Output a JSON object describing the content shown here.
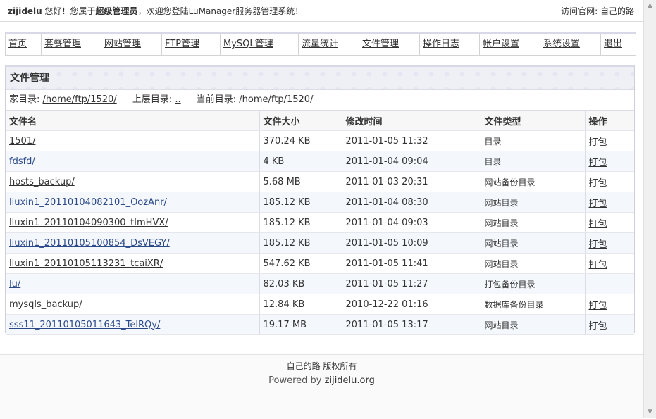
{
  "topbar": {
    "username": "zijidelu",
    "greeting": " 您好！您属于",
    "role": "超级管理员",
    "welcome": "，欢迎您登陆LuManager服务器管理系统！",
    "visit_label": "访问官网:",
    "visit_link": "自己的路"
  },
  "nav": {
    "items": [
      {
        "label": "首页"
      },
      {
        "label": "套餐管理"
      },
      {
        "label": "网站管理"
      },
      {
        "label": "FTP管理"
      },
      {
        "label": "MySQL管理"
      },
      {
        "label": "流量统计"
      },
      {
        "label": "文件管理"
      },
      {
        "label": "操作日志"
      },
      {
        "label": "帐户设置"
      },
      {
        "label": "系统设置"
      },
      {
        "label": "退出"
      }
    ]
  },
  "panel": {
    "title": "文件管理",
    "home_label": "家目录:",
    "home_path": "/home/ftp/1520/",
    "parent_label": "上层目录:",
    "parent_path": "..",
    "current_label": "当前目录:",
    "current_path": "/home/ftp/1520/"
  },
  "table": {
    "headers": [
      "文件名",
      "文件大小",
      "修改时间",
      "文件类型",
      "操作"
    ],
    "rows": [
      {
        "name": "1501/",
        "size": "370.24 KB",
        "mtime": "2011-01-05 11:32",
        "type": "目录",
        "action": "打包"
      },
      {
        "name": "fdsfd/",
        "size": "4 KB",
        "mtime": "2011-01-04 09:04",
        "type": "目录",
        "action": "打包"
      },
      {
        "name": "hosts_backup/",
        "size": "5.68 MB",
        "mtime": "2011-01-03 20:31",
        "type": "网站备份目录",
        "action": "打包"
      },
      {
        "name": "liuxin1_20110104082101_OozAnr/",
        "size": "185.12 KB",
        "mtime": "2011-01-04 08:30",
        "type": "网站目录",
        "action": "打包"
      },
      {
        "name": "liuxin1_20110104090300_tImHVX/",
        "size": "185.12 KB",
        "mtime": "2011-01-04 09:03",
        "type": "网站目录",
        "action": "打包"
      },
      {
        "name": "liuxin1_20110105100854_DsVEGY/",
        "size": "185.12 KB",
        "mtime": "2011-01-05 10:09",
        "type": "网站目录",
        "action": "打包"
      },
      {
        "name": "liuxin1_20110105113231_tcaiXR/",
        "size": "547.62 KB",
        "mtime": "2011-01-05 11:41",
        "type": "网站目录",
        "action": "打包"
      },
      {
        "name": "lu/",
        "size": "82.03 KB",
        "mtime": "2011-01-05 11:27",
        "type": "打包备份目录",
        "action": ""
      },
      {
        "name": "mysqls_backup/",
        "size": "12.84 KB",
        "mtime": "2010-12-22 01:16",
        "type": "数据库备份目录",
        "action": "打包"
      },
      {
        "name": "sss11_20110105011643_TelRQy/",
        "size": "19.17 MB",
        "mtime": "2011-01-05 13:17",
        "type": "网站目录",
        "action": "打包"
      }
    ]
  },
  "footer": {
    "site_link": "自己的路",
    "rights": "版权所有",
    "powered_by": "Powered by",
    "powered_link": "zijidelu.org"
  }
}
